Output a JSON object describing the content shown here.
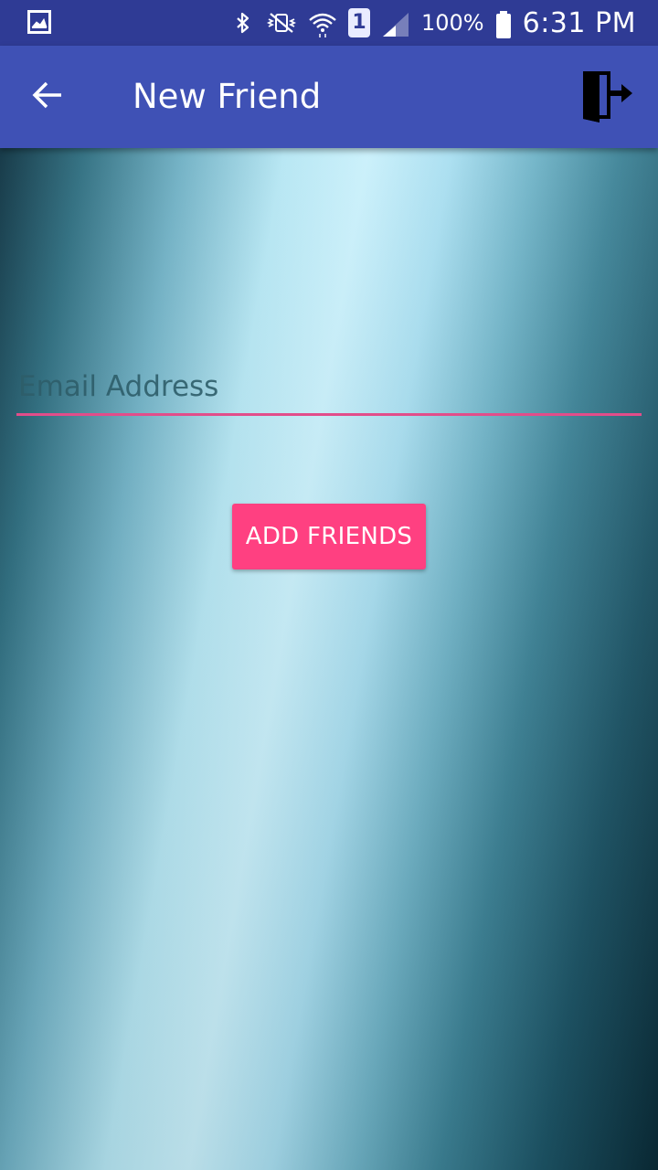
{
  "status_bar": {
    "left_icon": "gallery-icon",
    "icons": [
      "bluetooth-icon",
      "vibrate-mute-icon",
      "wifi-icon"
    ],
    "sim_number": "1",
    "signal_icon": "signal-icon",
    "battery_text": "100%",
    "battery_icon": "battery-icon",
    "time": "6:31 PM",
    "background": "#2f3b95"
  },
  "app_bar": {
    "title": "New Friend",
    "back_icon": "arrow-back-icon",
    "logout_icon": "logout-door-icon",
    "background": "#3f51b5"
  },
  "form": {
    "email_placeholder": "Email Address",
    "email_value": "",
    "underline_color": "#e24d8a",
    "add_button_label": "ADD FRIENDS",
    "button_color": "#ff4081"
  }
}
